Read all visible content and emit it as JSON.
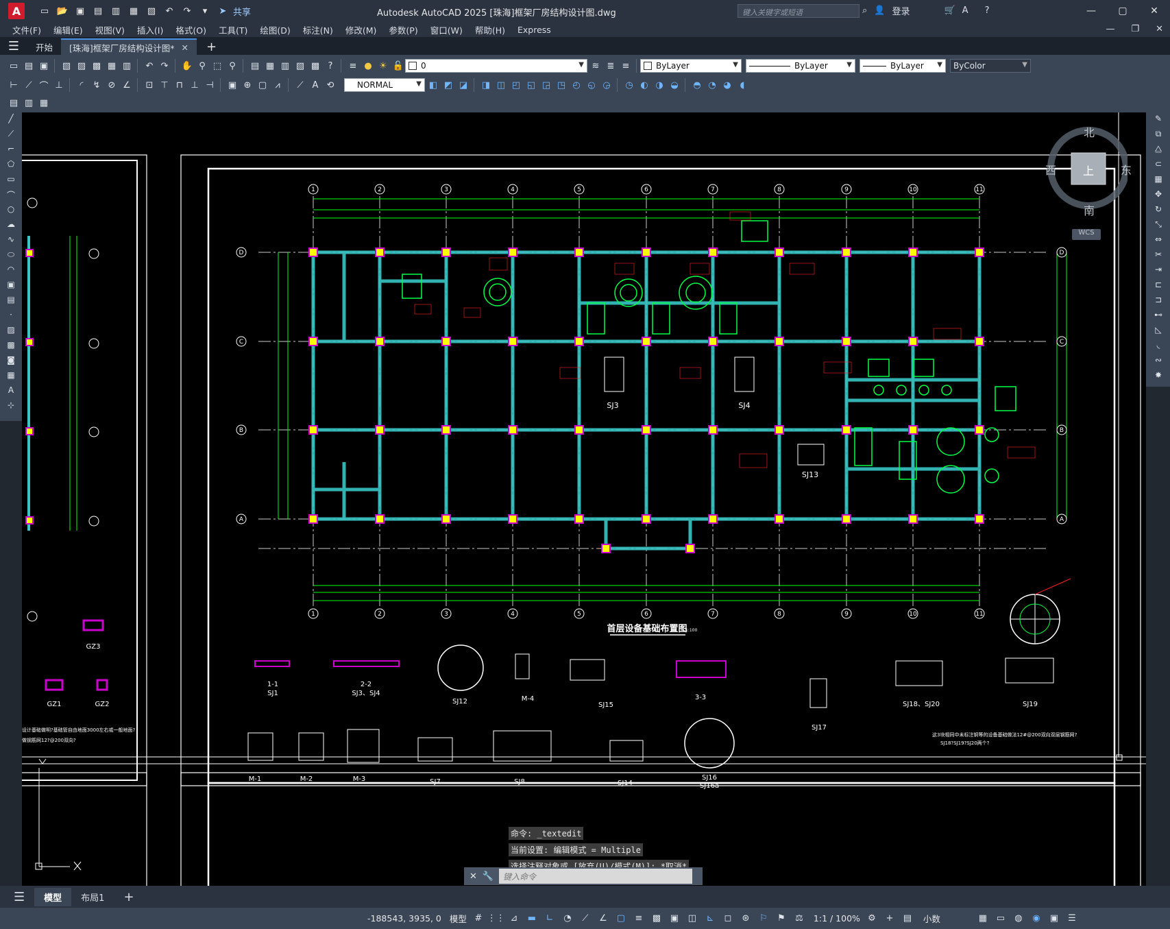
{
  "titlebar": {
    "logo": "A",
    "share_label": "共享",
    "title": "Autodesk AutoCAD 2025    [珠海]框架厂房结构设计图.dwg",
    "search_placeholder": "键入关键字或短语",
    "login_label": "登录"
  },
  "menu": [
    "文件(F)",
    "编辑(E)",
    "视图(V)",
    "插入(I)",
    "格式(O)",
    "工具(T)",
    "绘图(D)",
    "标注(N)",
    "修改(M)",
    "参数(P)",
    "窗口(W)",
    "帮助(H)",
    "Express"
  ],
  "file_tabs": {
    "start": "开始",
    "active": "[珠海]框架厂房结构设计图*"
  },
  "toolbar": {
    "layer_value": "0",
    "visual_style": "NORMAL",
    "color": "ByLayer",
    "linetype": "ByLayer",
    "lineweight": "ByLayer",
    "plotstyle": "ByColor"
  },
  "viewcube": {
    "north": "北",
    "south": "南",
    "east": "东",
    "west": "西",
    "top": "上",
    "wcs": "WCS"
  },
  "drawing": {
    "main_title": "首层设备基础布置图",
    "main_scale": "1:100",
    "grid_cols": [
      "1",
      "2",
      "3",
      "4",
      "5",
      "6",
      "7",
      "8",
      "9",
      "10",
      "11"
    ],
    "grid_rows": [
      "D",
      "C",
      "B",
      "A"
    ],
    "labels": {
      "sj3": "SJ3",
      "sj4": "SJ4",
      "sj13": "SJ13",
      "gz3": "GZ3",
      "gz1": "GZ1",
      "gz2": "GZ2",
      "sec11": "1-1",
      "sj1": "SJ1",
      "sec22": "2-2",
      "sj3sj4": "SJ3、SJ4",
      "sj12": "SJ12",
      "m4": "M-4",
      "sj15": "SJ15",
      "sec33": "3-3",
      "sj17": "SJ17",
      "sj18": "SJ18、SJ20",
      "sj19": "SJ19",
      "m1": "M-1",
      "m2": "M-2",
      "m3": "M-3",
      "sj7": "SJ7",
      "sj8": "SJ8",
      "sj14": "SJ14",
      "sj16": "SJ16",
      "sj16a": "SJ16a",
      "note1": "这3块相同中未标注铜等的设备基础做法12#@200双向双层钢筋网?",
      "note2": "SJ18?SJ19?SJ20两个?",
      "leftnote1": "设计基础做明?基础管自由地面3000左右或一般地面?",
      "leftnote2": "做钢筋网12?@200双向?"
    }
  },
  "commandline": {
    "line1": "命令: _textedit",
    "line2": "当前设置: 编辑模式 = Multiple",
    "line3": "选择注释对象或 [放弃(U)/模式(M)]: *取消*",
    "placeholder": "键入命令"
  },
  "layout_tabs": [
    "模型",
    "布局1"
  ],
  "status": {
    "coords": "-188543, 3935, 0",
    "model": "模型",
    "scale": "1:1 / 100%",
    "units": "小数"
  }
}
